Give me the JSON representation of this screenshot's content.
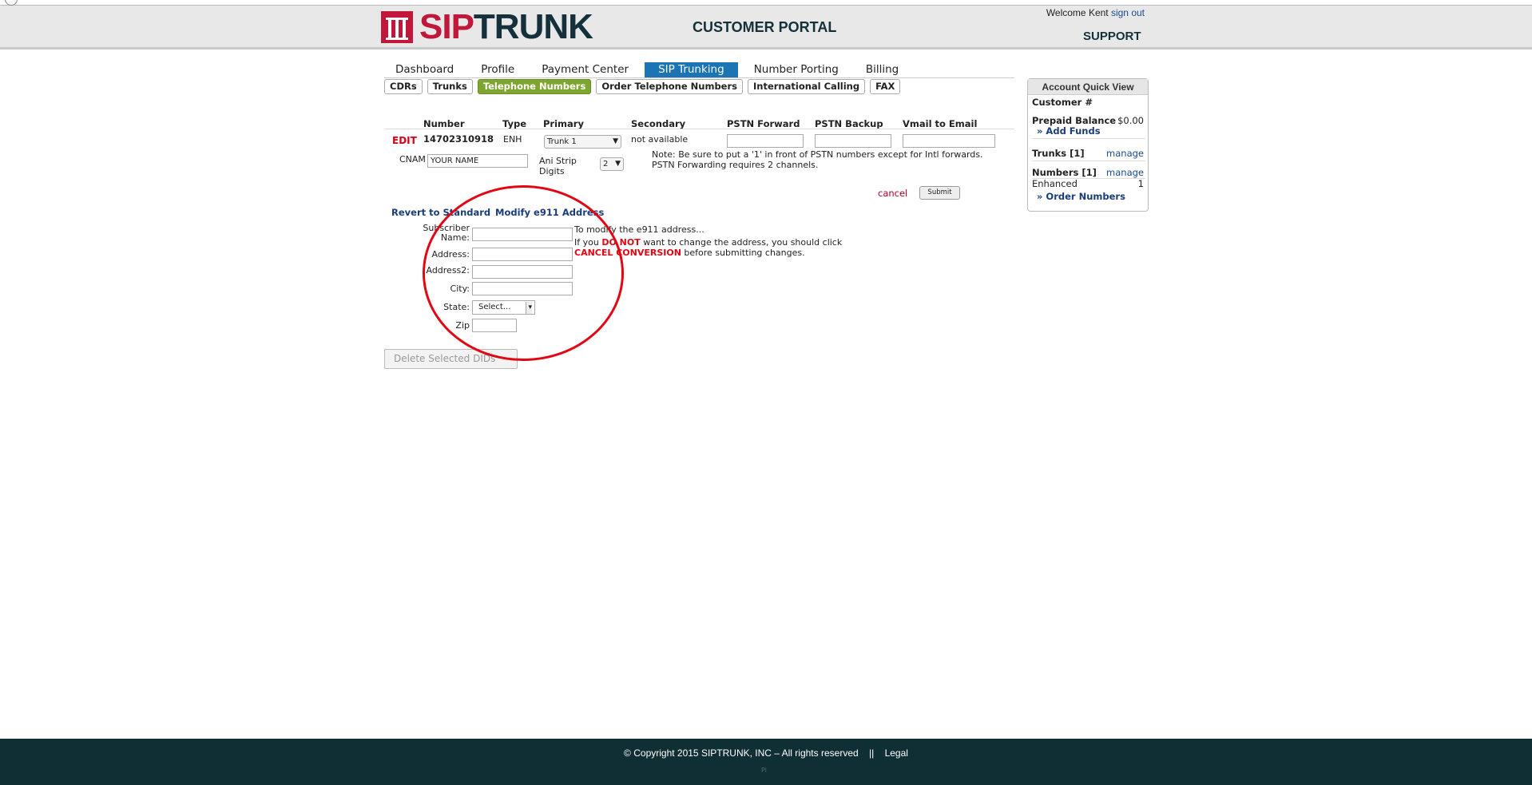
{
  "header": {
    "logo_red": "SIP",
    "logo_dark": "TRUNK",
    "portal_title": "CUSTOMER PORTAL",
    "welcome_text": "Welcome Kent",
    "sign_out": "sign out",
    "support": "SUPPORT"
  },
  "tabs": [
    {
      "label": "Dashboard"
    },
    {
      "label": "Profile"
    },
    {
      "label": "Payment Center"
    },
    {
      "label": "SIP Trunking"
    },
    {
      "label": "Number Porting"
    },
    {
      "label": "Billing"
    }
  ],
  "active_tab": "SIP Trunking",
  "subtabs": [
    {
      "label": "CDRs"
    },
    {
      "label": "Trunks"
    },
    {
      "label": "Telephone Numbers"
    },
    {
      "label": "Order Telephone Numbers"
    },
    {
      "label": "International Calling"
    },
    {
      "label": "FAX"
    }
  ],
  "active_subtab": "Telephone Numbers",
  "table": {
    "headers": {
      "number": "Number",
      "type": "Type",
      "primary": "Primary",
      "secondary": "Secondary",
      "pstn_forward": "PSTN Forward",
      "pstn_backup": "PSTN Backup",
      "vmail": "Vmail to Email"
    },
    "row": {
      "edit": "EDIT",
      "number": "14702310918",
      "type": "ENH",
      "primary_value": "Trunk 1",
      "secondary": "not available",
      "cnam_label": "CNAM",
      "cnam_value": "YOUR NAME",
      "ani_label_1": "Ani Strip",
      "ani_label_2": "Digits",
      "ani_value": "2"
    },
    "note_1": "Note: Be sure to put a '1' in front of PSTN numbers except for Intl forwards.",
    "note_2": "PSTN Forwarding requires 2 channels.",
    "cancel": "cancel",
    "submit": "Submit"
  },
  "e911": {
    "revert": "Revert to Standard",
    "modify": "Modify e911 Address",
    "labels": {
      "subscriber_1": "Subscriber",
      "subscriber_2": "Name:",
      "address": "Address:",
      "address2": "Address2:",
      "city": "City:",
      "state": "State:",
      "zip": "Zip"
    },
    "state_placeholder": "Select...",
    "info_1": "To modify the e911 address...",
    "info_2_pre": "If you",
    "info_2_red": "DO NOT",
    "info_2_post": "want to change the address, you should click",
    "info_3_red": "CANCEL CONVERSION",
    "info_3_post": "before submitting changes."
  },
  "delete_button": "Delete Selected DIDs",
  "quick_view": {
    "title": "Account Quick View",
    "customer_label": "Customer #",
    "prepaid_label": "Prepaid Balance",
    "prepaid_value": "$0.00",
    "add_funds": "» Add Funds",
    "trunks_label": "Trunks [1]",
    "trunks_manage": "manage",
    "numbers_label": "Numbers [1]",
    "numbers_manage": "manage",
    "enhanced_label": "Enhanced",
    "enhanced_value": "1",
    "order_numbers": "» Order Numbers"
  },
  "footer": {
    "copyright": "© Copyright 2015 SIPTRUNK, INC – All rights reserved    ||    Legal",
    "pi": "Pi"
  },
  "colors": {
    "brand_red": "#c0173b",
    "brand_dark": "#14303a",
    "active_tab": "#1b75b4",
    "active_subtab": "#7ea52f",
    "annotation_circle": "#e30613",
    "footer": "#0f2f35"
  }
}
